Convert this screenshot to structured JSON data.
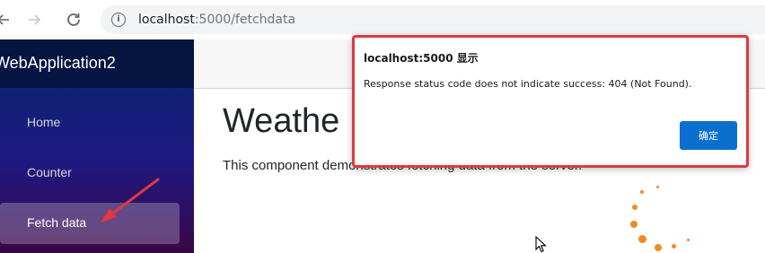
{
  "browser": {
    "back_icon": "arrow-left-icon",
    "forward_icon": "arrow-right-icon",
    "reload_icon": "reload-icon",
    "info_icon": "info-icon",
    "url_host": "localhost",
    "url_rest": ":5000/fetchdata"
  },
  "sidebar": {
    "brand": "WebApplication2",
    "items": [
      {
        "label": "Home"
      },
      {
        "label": "Counter"
      },
      {
        "label": "Fetch data"
      }
    ],
    "active_index": 2
  },
  "main": {
    "title": "Weathe",
    "description": "This component demonstrates fetching data from the server."
  },
  "dialog": {
    "title": "localhost:5000 显示",
    "message": "Response status code does not indicate success: 404 (Not Found).",
    "ok_label": "确定"
  },
  "colors": {
    "accent": "#0b6fd0",
    "highlight_border": "#e0393e",
    "spinner": "#f08a24",
    "annotation_arrow": "#e0393e"
  }
}
